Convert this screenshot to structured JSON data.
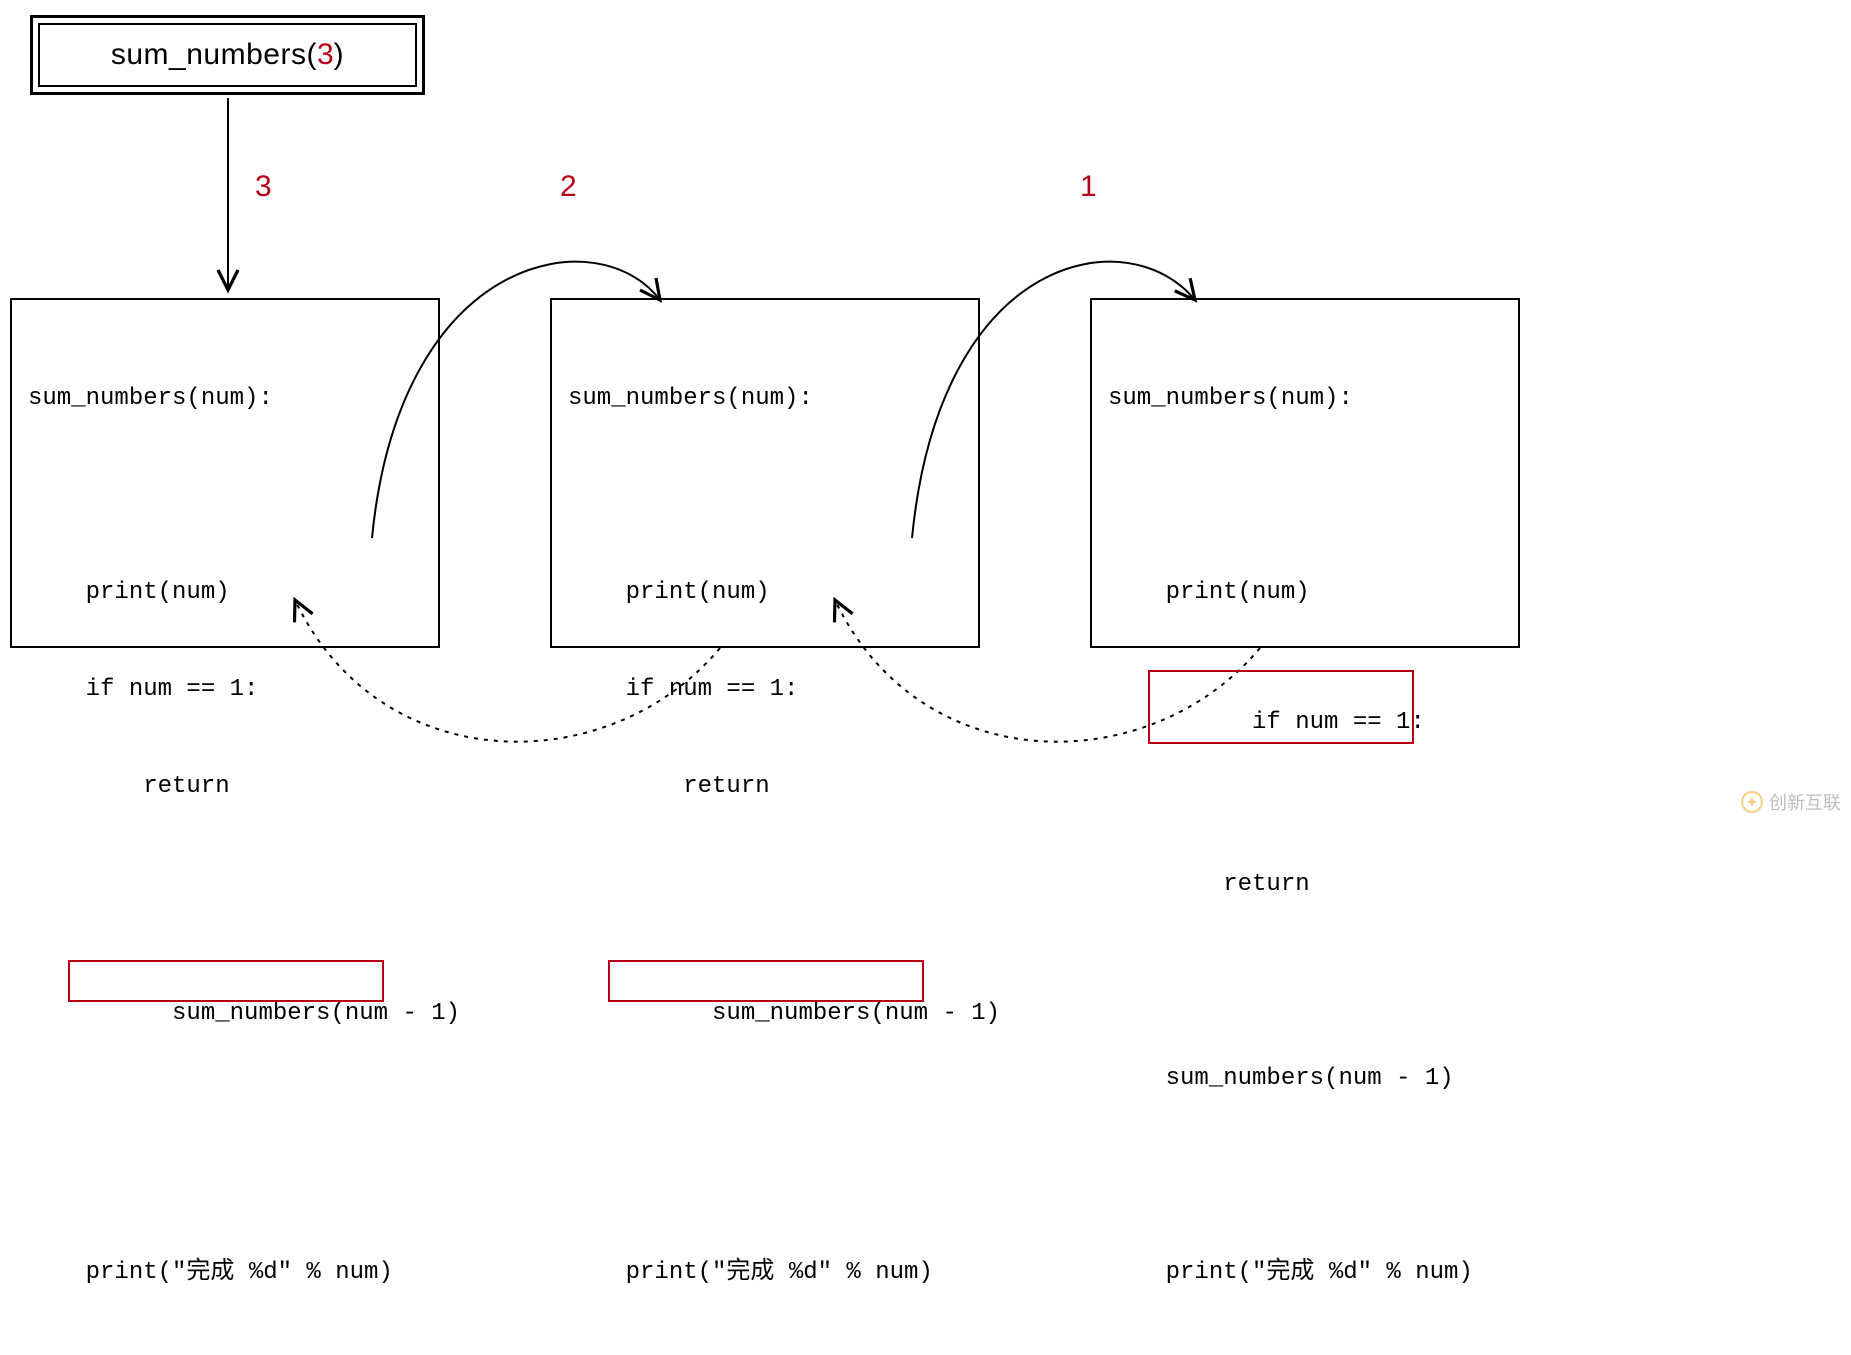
{
  "colors": {
    "accent": "#b80017",
    "border": "#000000"
  },
  "entry": {
    "fn": "sum_numbers",
    "arg": "3"
  },
  "steps": {
    "s1": "3",
    "s2": "2",
    "s3": "1"
  },
  "frames": [
    {
      "header": "sum_numbers(num):",
      "l1": "    print(num)",
      "l2": "    if num == 1:",
      "l3": "        return",
      "call": "    sum_numbers(num - 1)",
      "l5": "    print(\"完成 %d\" % num)",
      "highlight": "call"
    },
    {
      "header": "sum_numbers(num):",
      "l1": "    print(num)",
      "l2": "    if num == 1:",
      "l3": "        return",
      "call": "    sum_numbers(num - 1)",
      "l5": "    print(\"完成 %d\" % num)",
      "highlight": "call"
    },
    {
      "header": "sum_numbers(num):",
      "l1": "    print(num)",
      "l2": "    if num == 1:",
      "l3": "        return",
      "call": "    sum_numbers(num - 1)",
      "l5": "    print(\"完成 %d\" % num)",
      "highlight": "return"
    }
  ],
  "watermark": "创新互联"
}
